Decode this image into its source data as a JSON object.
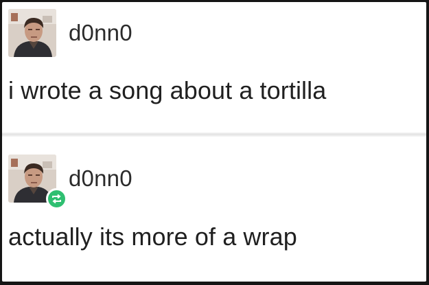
{
  "posts": [
    {
      "username": "d0nn0",
      "text": "i wrote a song about a tortilla",
      "reblogged": false
    },
    {
      "username": "d0nn0",
      "text": "actually its more of a wrap",
      "reblogged": true
    }
  ],
  "icons": {
    "avatar": "avatar-photo",
    "reblog": "reblog-icon"
  },
  "colors": {
    "background": "#151515",
    "card": "#ffffff",
    "text": "#202020",
    "reblog_badge": "#2fbf71"
  }
}
